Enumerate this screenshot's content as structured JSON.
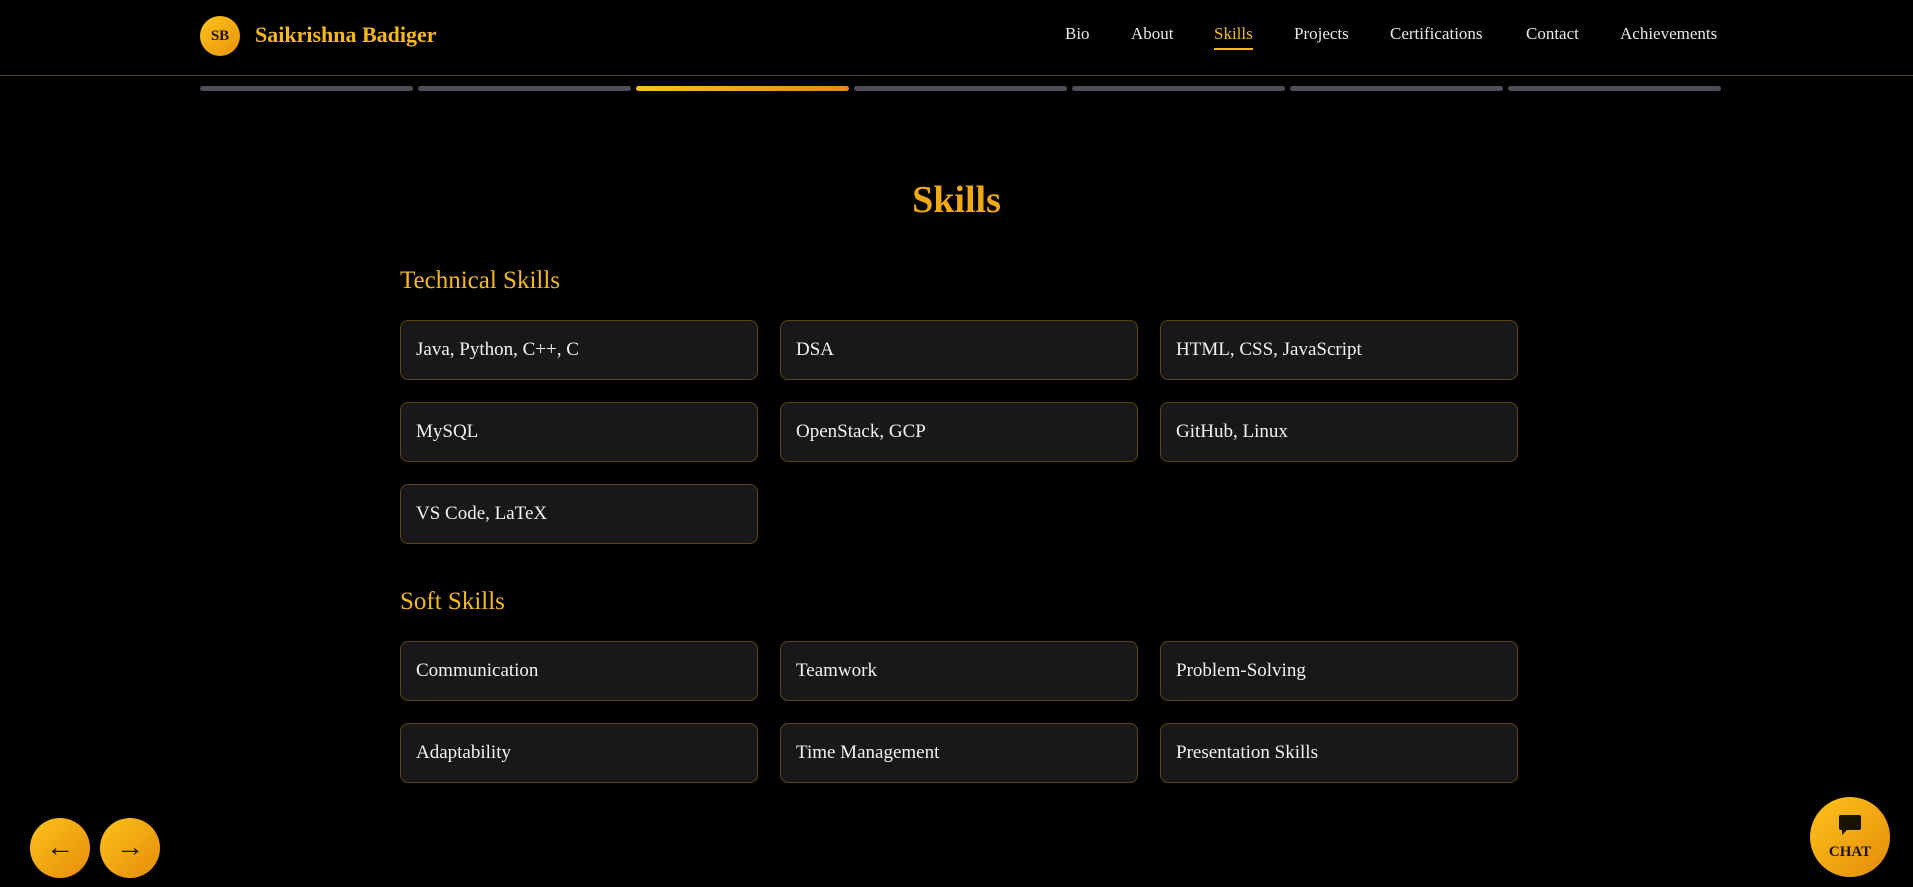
{
  "header": {
    "logo_initials": "SB",
    "brand_name": "Saikrishna Badiger",
    "nav": [
      {
        "label": "Bio"
      },
      {
        "label": "About"
      },
      {
        "label": "Skills",
        "active": true
      },
      {
        "label": "Projects"
      },
      {
        "label": "Certifications"
      },
      {
        "label": "Contact"
      },
      {
        "label": "Achievements"
      }
    ]
  },
  "progress": {
    "total_steps": 7,
    "current_step": 3
  },
  "main": {
    "title": "Skills",
    "technical": {
      "heading": "Technical Skills",
      "items": [
        "Java, Python, C++, C",
        "DSA",
        "HTML, CSS, JavaScript",
        "MySQL",
        "OpenStack, GCP",
        "GitHub, Linux",
        "VS Code, LaTeX"
      ]
    },
    "soft": {
      "heading": "Soft Skills",
      "items": [
        "Communication",
        "Teamwork",
        "Problem-Solving",
        "Adaptability",
        "Time Management",
        "Presentation Skills"
      ]
    }
  },
  "controls": {
    "prev_symbol": "←",
    "next_symbol": "→",
    "chat_label": "CHAT"
  },
  "colors": {
    "accent": "#f5b91a",
    "title": "#f0a814",
    "card_bg": "#181818",
    "card_border": "#5c4510",
    "progress_inactive": "#4a4f58"
  },
  "icons": {
    "chat": "chat-bubble-icon",
    "prev": "arrow-left-icon",
    "next": "arrow-right-icon"
  }
}
